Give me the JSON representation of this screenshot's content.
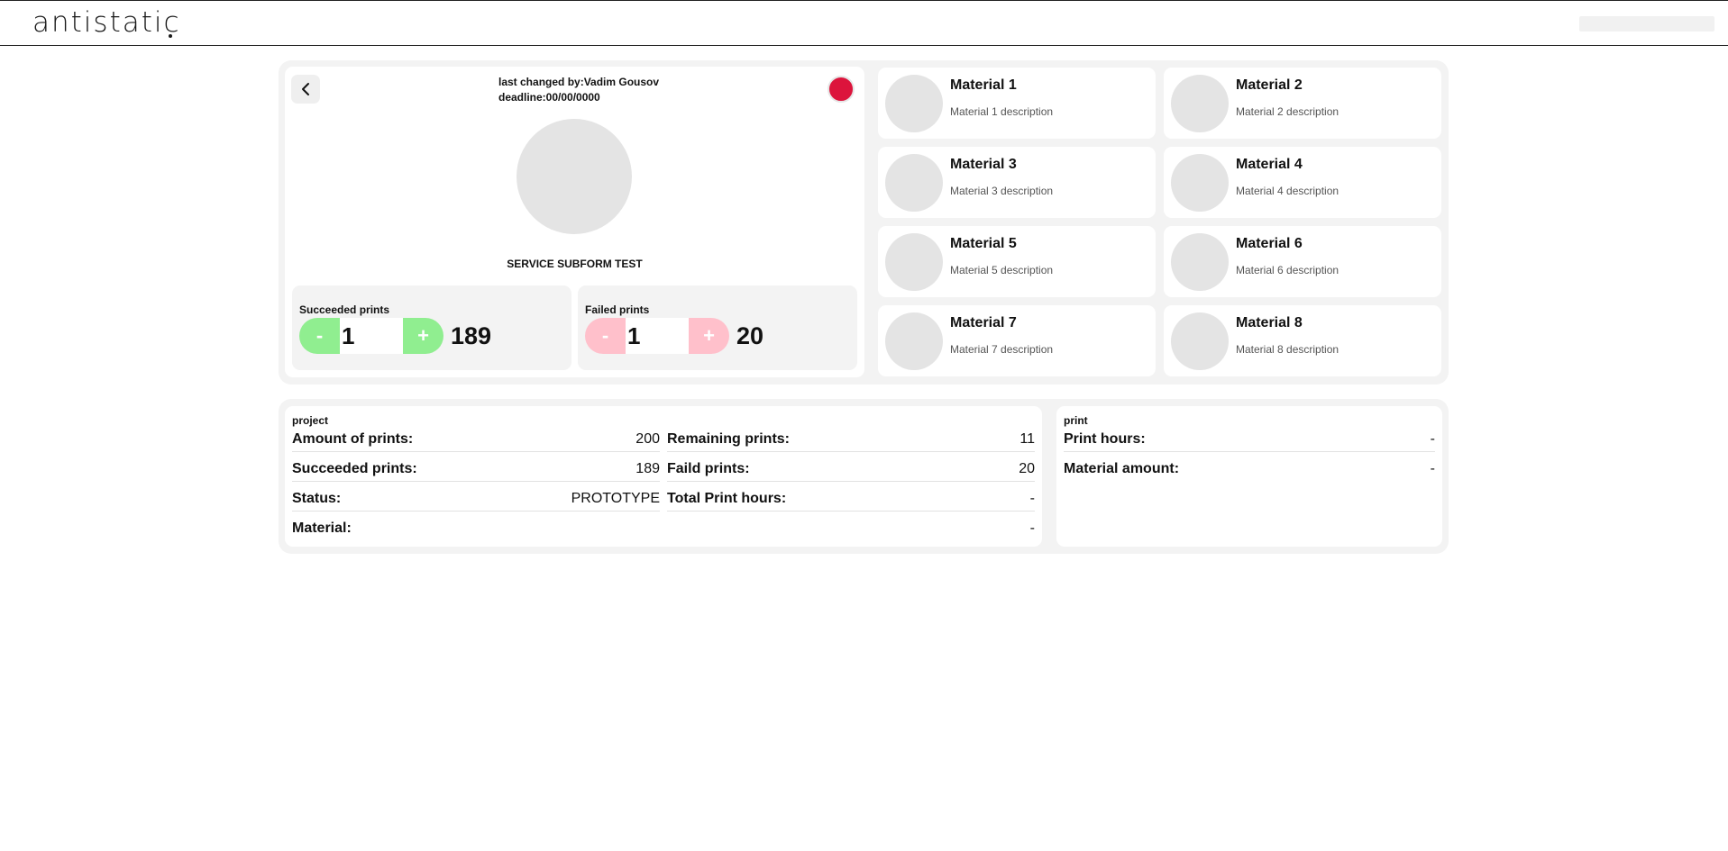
{
  "header": {
    "logo": "antistatic"
  },
  "service": {
    "last_changed": "last changed by:Vadim Gousov",
    "deadline": "deadline:00/00/0000",
    "title": "SERVICE SUBFORM TEST",
    "status_color": "#dc143c",
    "succeeded": {
      "label": "Succeeded prints",
      "minus": "-",
      "plus": "+",
      "input_value": "1",
      "total": "189",
      "color": "#90ee90"
    },
    "failed": {
      "label": "Failed prints",
      "minus": "-",
      "plus": "+",
      "input_value": "1",
      "total": "20",
      "color": "#ffc0cb"
    }
  },
  "materials": [
    {
      "name": "Material 1",
      "description": "Material 1 description"
    },
    {
      "name": "Material 2",
      "description": "Material 2 description"
    },
    {
      "name": "Material 3",
      "description": "Material 3 description"
    },
    {
      "name": "Material 4",
      "description": "Material 4 description"
    },
    {
      "name": "Material 5",
      "description": "Material 5 description"
    },
    {
      "name": "Material 6",
      "description": "Material 6 description"
    },
    {
      "name": "Material 7",
      "description": "Material 7 description"
    },
    {
      "name": "Material 8",
      "description": "Material 8 description"
    }
  ],
  "project": {
    "section_label": "project",
    "amount_label": "Amount of prints:",
    "amount_value": "200",
    "succeeded_label": "Succeeded prints:",
    "succeeded_value": "189",
    "status_label": "Status:",
    "status_value": "PROTOTYPE",
    "material_label": "Material:",
    "material_value": "-",
    "remaining_label": "Remaining prints:",
    "remaining_value": "11",
    "failed_label": "Faild prints:",
    "failed_value": "20",
    "total_hours_label": "Total Print hours:",
    "total_hours_value": "-"
  },
  "print": {
    "section_label": "print",
    "hours_label": "Print hours:",
    "hours_value": "-",
    "material_amount_label": "Material amount:",
    "material_amount_value": "-"
  }
}
